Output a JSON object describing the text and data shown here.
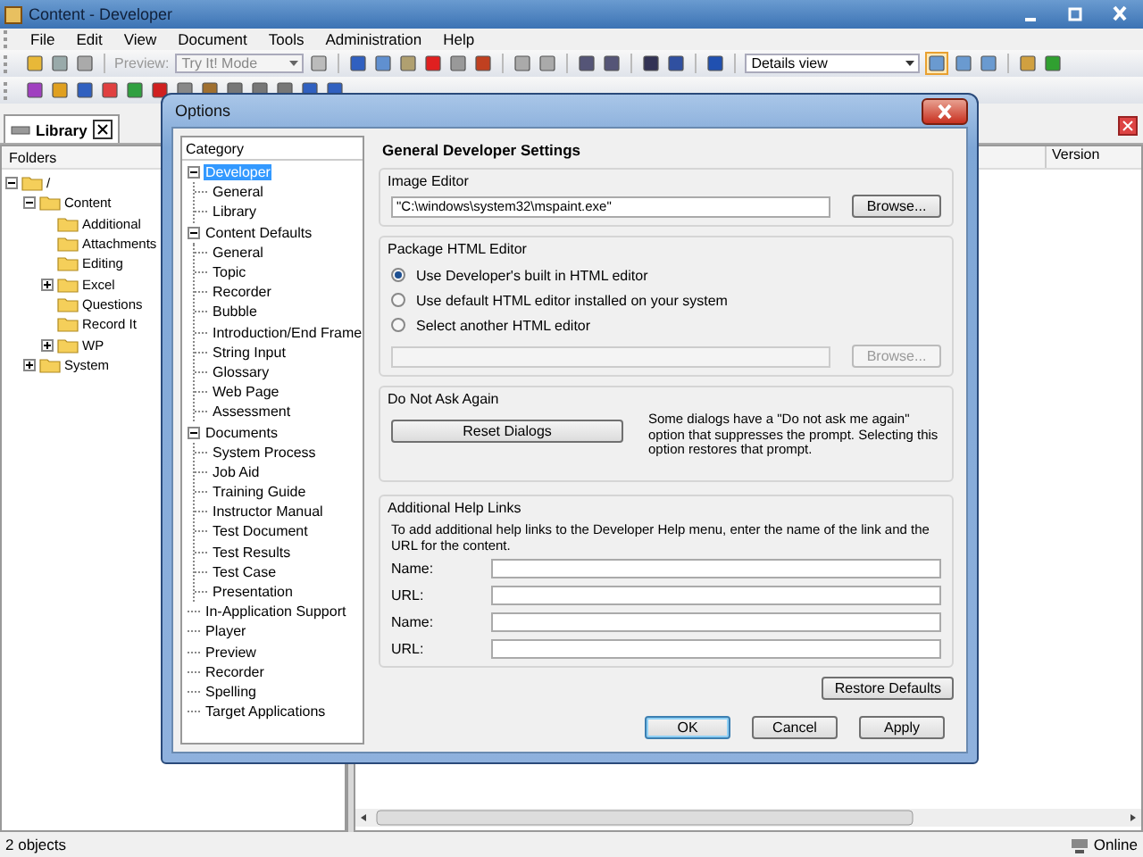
{
  "window": {
    "title": "Content - Developer"
  },
  "menu": [
    "File",
    "Edit",
    "View",
    "Document",
    "Tools",
    "Administration",
    "Help"
  ],
  "toolbar": {
    "preview_label": "Preview:",
    "mode_combo": {
      "value": "Try It! Mode",
      "disabled": true
    },
    "view_combo": {
      "value": "Details view",
      "disabled": false
    }
  },
  "library_tab": {
    "label": "Library"
  },
  "folders": {
    "header": "Folders",
    "tree": [
      {
        "label": "/",
        "expanded": true,
        "children": [
          {
            "label": "Content",
            "expanded": true,
            "children": [
              {
                "label": "Additional"
              },
              {
                "label": "Attachments"
              },
              {
                "label": "Editing"
              },
              {
                "label": "Excel",
                "expanded": false
              },
              {
                "label": "Questions"
              },
              {
                "label": "Record It"
              },
              {
                "label": "WP",
                "expanded": false
              }
            ]
          },
          {
            "label": "System",
            "expanded": false
          }
        ]
      }
    ]
  },
  "list": {
    "columns": [
      "Version"
    ]
  },
  "status_bar": {
    "count": "2 objects",
    "connection": "Online"
  },
  "dialog": {
    "title": "Options",
    "category_header": "Category",
    "categories": [
      {
        "label": "Developer",
        "selected": true,
        "expanded": true,
        "children": [
          {
            "label": "General",
            "selected": false
          },
          {
            "label": "Library",
            "selected": false
          }
        ]
      },
      {
        "label": "Content Defaults",
        "selected": false,
        "expanded": true,
        "children": [
          {
            "label": "General",
            "selected": false
          },
          {
            "label": "Topic",
            "selected": false
          },
          {
            "label": "Recorder",
            "selected": false
          },
          {
            "label": "Bubble",
            "selected": false
          },
          {
            "label": "Introduction/End Frame",
            "selected": false
          },
          {
            "label": "String Input",
            "selected": false
          },
          {
            "label": "Glossary",
            "selected": false
          },
          {
            "label": "Web Page",
            "selected": false
          },
          {
            "label": "Assessment",
            "selected": false
          }
        ]
      },
      {
        "label": "Documents",
        "selected": false,
        "expanded": true,
        "children": [
          {
            "label": "System Process",
            "selected": false
          },
          {
            "label": "Job Aid",
            "selected": false
          },
          {
            "label": "Training Guide",
            "selected": false
          },
          {
            "label": "Instructor Manual",
            "selected": false
          },
          {
            "label": "Test Document",
            "selected": false
          },
          {
            "label": "Test Results",
            "selected": false
          },
          {
            "label": "Test Case",
            "selected": false
          },
          {
            "label": "Presentation",
            "selected": false
          }
        ]
      },
      {
        "label": "In-Application Support",
        "selected": false
      },
      {
        "label": "Player",
        "selected": false
      },
      {
        "label": "Preview",
        "selected": false
      },
      {
        "label": "Recorder",
        "selected": false
      },
      {
        "label": "Spelling",
        "selected": false
      },
      {
        "label": "Target Applications",
        "selected": false
      }
    ],
    "heading": "General Developer Settings",
    "image_editor": {
      "legend": "Image Editor",
      "value": "\"C:\\windows\\system32\\mspaint.exe\"",
      "button": "Browse..."
    },
    "html_editor": {
      "legend": "Package HTML Editor",
      "options": [
        {
          "label": "Use Developer's built in HTML editor",
          "selected": true
        },
        {
          "label": "Use default HTML editor installed on your system",
          "selected": false
        },
        {
          "label": "Select another HTML editor",
          "selected": false
        }
      ],
      "path_disabled": true,
      "button": {
        "label": "Browse...",
        "disabled": true
      }
    },
    "do_not_ask": {
      "legend": "Do Not Ask Again",
      "button": "Reset Dialogs",
      "note": "Some dialogs have a \"Do not ask me again\" option that suppresses the prompt. Selecting this option restores that prompt."
    },
    "help_links": {
      "legend": "Additional Help Links",
      "intro": "To add additional help links to the Developer Help menu, enter the name of the link and the URL for the content.",
      "fields": [
        {
          "label": "Name:"
        },
        {
          "label": "URL:"
        },
        {
          "label": "Name:"
        },
        {
          "label": "URL:"
        }
      ]
    },
    "restore_button": "Restore Defaults",
    "buttons": [
      {
        "label": "OK",
        "default": true
      },
      {
        "label": "Cancel",
        "default": false
      },
      {
        "label": "Apply",
        "default": false
      }
    ]
  }
}
